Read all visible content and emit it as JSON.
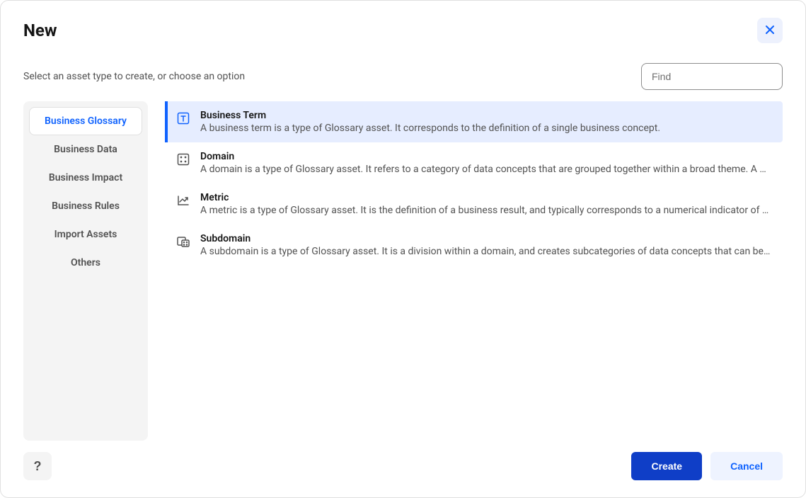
{
  "dialog": {
    "title": "New",
    "subtitle": "Select an asset type to create, or choose an option"
  },
  "search": {
    "placeholder": "Find",
    "value": ""
  },
  "sidebar": {
    "items": [
      {
        "label": "Business Glossary",
        "active": true
      },
      {
        "label": "Business Data",
        "active": false
      },
      {
        "label": "Business Impact",
        "active": false
      },
      {
        "label": "Business Rules",
        "active": false
      },
      {
        "label": "Import Assets",
        "active": false
      },
      {
        "label": "Others",
        "active": false
      }
    ]
  },
  "assets": [
    {
      "icon": "term-icon",
      "title": "Business Term",
      "description": "A business term is a type of Glossary asset. It corresponds to the definition of a single business concept.",
      "selected": true
    },
    {
      "icon": "domain-icon",
      "title": "Domain",
      "description": "A domain is a type of Glossary asset. It refers to a category of data concepts that are grouped together within a broad theme. A do…",
      "selected": false
    },
    {
      "icon": "metric-icon",
      "title": "Metric",
      "description": "A metric is a type of Glossary asset. It is the definition of a business result, and typically corresponds to a numerical indicator of bu…",
      "selected": false
    },
    {
      "icon": "subdomain-icon",
      "title": "Subdomain",
      "description": "A subdomain is a type of Glossary asset. It is a division within a domain, and creates subcategories of data concepts that can be gr…",
      "selected": false
    }
  ],
  "footer": {
    "help": "?",
    "create": "Create",
    "cancel": "Cancel"
  }
}
